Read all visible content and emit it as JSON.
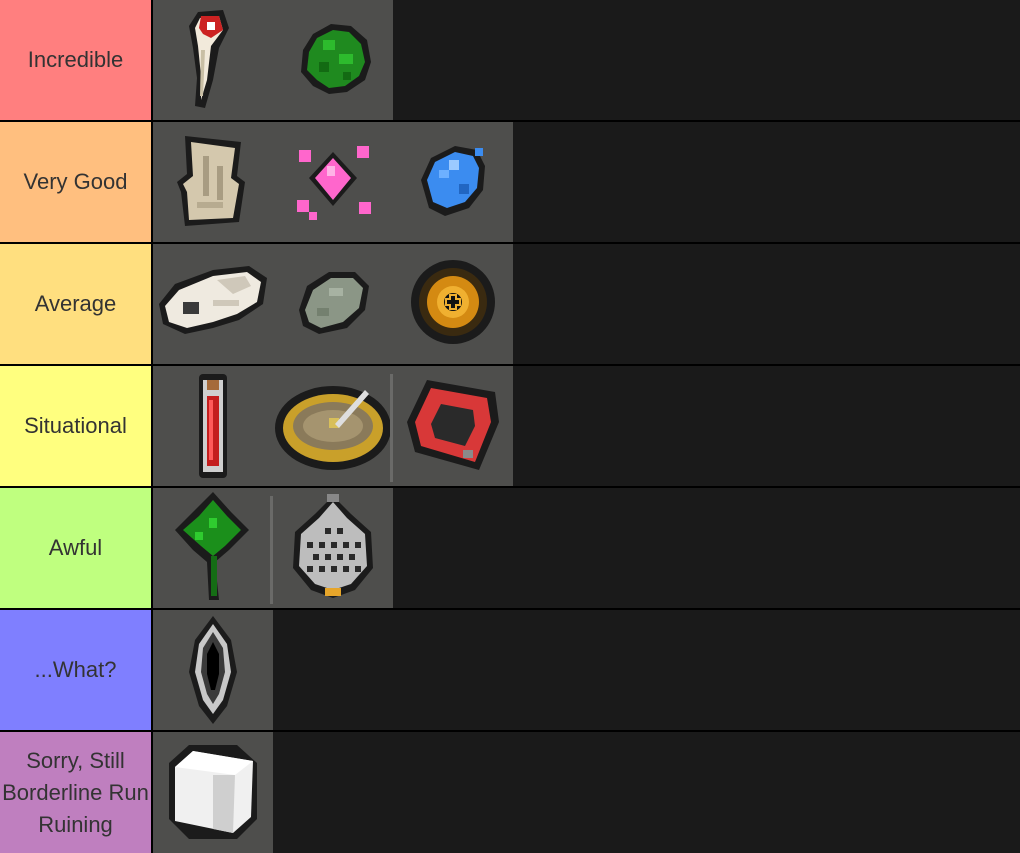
{
  "tiers": [
    {
      "label": "Incredible",
      "color": "#ff7f7f",
      "items": [
        "bone-fang-icon",
        "green-moss-icon"
      ]
    },
    {
      "label": "Very Good",
      "color": "#ffbf7f",
      "items": [
        "ancient-scroll-icon",
        "pink-crystal-icon",
        "blue-gem-icon"
      ]
    },
    {
      "label": "Average",
      "color": "#ffdf7f",
      "items": [
        "animal-skull-icon",
        "grey-stone-icon",
        "golden-eye-icon"
      ]
    },
    {
      "label": "Situational",
      "color": "#ffff7f",
      "items": [
        "red-vial-icon",
        "brass-compass-icon",
        "red-ring-icon"
      ]
    },
    {
      "label": "Awful",
      "color": "#bfff7f",
      "items": [
        "clover-leaf-icon",
        "grated-ornament-icon"
      ]
    },
    {
      "label": "...What?",
      "color": "#7f7fff",
      "items": [
        "void-portal-icon"
      ]
    },
    {
      "label": "Sorry, Still Borderline Run Ruining",
      "color": "#bf7fbf",
      "items": [
        "white-cube-icon"
      ]
    }
  ]
}
